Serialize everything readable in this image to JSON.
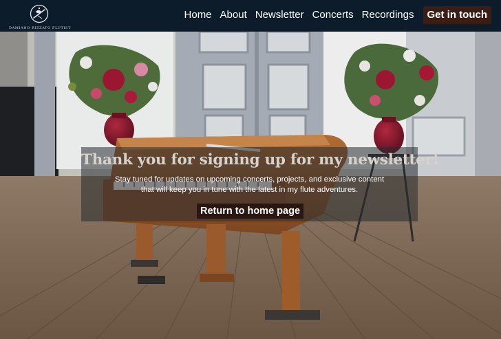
{
  "header": {
    "logo_text": "DAMIANO RIZZATO FLUTIST",
    "nav": [
      "Home",
      "About",
      "Newsletter",
      "Concerts",
      "Recordings"
    ],
    "cta_label": "Get in touch"
  },
  "hero": {
    "title": "Thank you for signing up for my newsletter!",
    "body_line1": "Stay tuned for updates on upcoming concerts, projects, and exclusive content",
    "body_line2": "that will keep you in tune with the latest in my flute adventures.",
    "button_label": "Return to home page"
  },
  "colors": {
    "header_bg": "#0c1c2b",
    "button_bg": "#2a1711",
    "cta_bg": "#3a1d14"
  },
  "icons": [
    "flute-logo-icon"
  ]
}
